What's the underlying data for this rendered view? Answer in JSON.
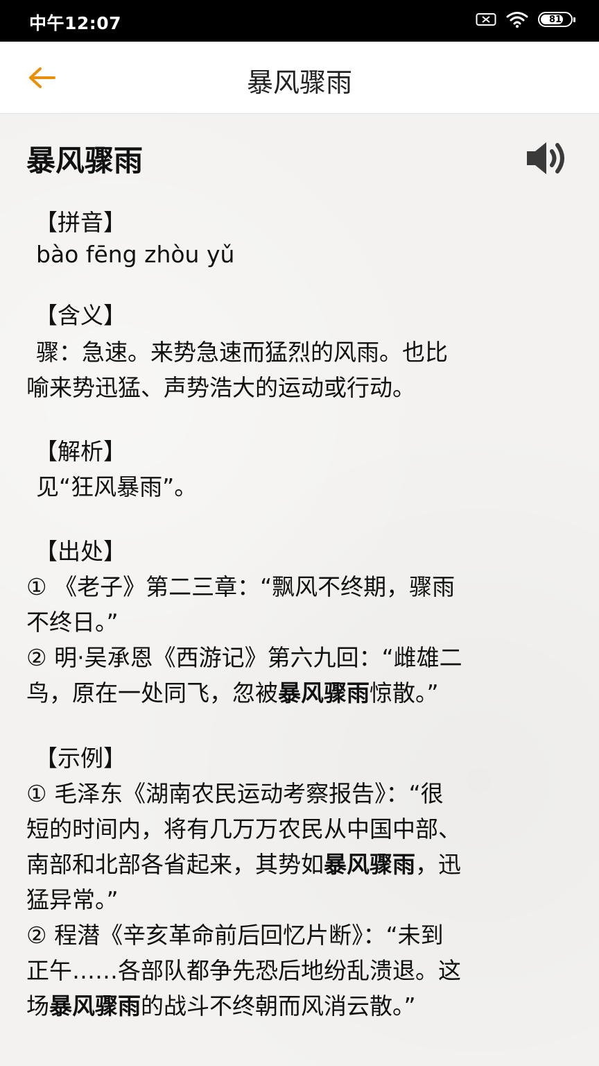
{
  "status_bar": {
    "time": "中午12:07",
    "battery_level": "81",
    "battery_percent": 81
  },
  "header": {
    "title": "暴风骤雨"
  },
  "entry": {
    "word": "暴风骤雨",
    "pinyin": {
      "heading": "【拼音】",
      "text": "bào fēng zhòu yǔ"
    },
    "meaning": {
      "heading": "【含义】",
      "line1": "骤：急速。来势急速而猛烈的风雨。也比",
      "line2": "喻来势迅猛、声势浩大的运动或行动。"
    },
    "analysis": {
      "heading": "【解析】",
      "text": "见“狂风暴雨”。"
    },
    "source": {
      "heading": "【出处】",
      "item1_line1": "① 《老子》第二三章：“飘风不终期，骤雨",
      "item1_line2": "不终日。”",
      "item2_line1": "② 明·吴承恩《西游记》第六九回：“雌雄二",
      "item2_line2_pre": "鸟，原在一处同飞，忽被",
      "item2_line2_kw": "暴风骤雨",
      "item2_line2_post": "惊散。”"
    },
    "example": {
      "heading": "【示例】",
      "item1_line1": "① 毛泽东《湖南农民运动考察报告》：“很",
      "item1_line2": "短的时间内，将有几万万农民从中国中部、",
      "item1_line3_pre": "南部和北部各省起来，其势如",
      "item1_line3_kw": "暴风骤雨",
      "item1_line3_post": "，迅",
      "item1_line4": "猛异常。”",
      "item2_line1": "② 程潜《辛亥革命前后回忆片断》：“未到",
      "item2_line2": "正午……各部队都争先恐后地纷乱溃退。这",
      "item2_line3_pre": "场",
      "item2_line3_kw": "暴风骤雨",
      "item2_line3_post": "的战斗不终朝而风消云散。”"
    }
  },
  "colors": {
    "accent": "#e8900c",
    "status_bar_bg": "#000000",
    "header_bg": "#ffffff",
    "content_bg": "#f3f2f0"
  },
  "icons": {
    "back": "arrow-left-icon",
    "speaker": "speaker-volume-icon",
    "sim": "sim-icon",
    "wifi": "wifi-icon"
  }
}
